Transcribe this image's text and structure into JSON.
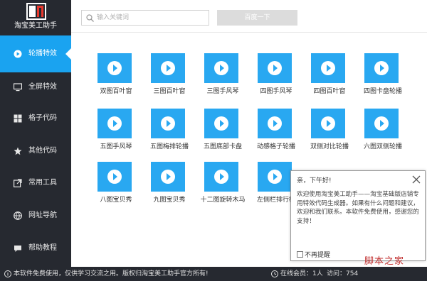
{
  "app": {
    "title": "淘宝美工助手"
  },
  "sidebar": {
    "items": [
      {
        "label": "轮播特效",
        "icon": "play-icon",
        "active": true
      },
      {
        "label": "全屏特效",
        "icon": "monitor-icon",
        "active": false
      },
      {
        "label": "格子代码",
        "icon": "grid-icon",
        "active": false
      },
      {
        "label": "其他代码",
        "icon": "star-icon",
        "active": false
      },
      {
        "label": "常用工具",
        "icon": "external-link-icon",
        "active": false
      },
      {
        "label": "网址导航",
        "icon": "globe-icon",
        "active": false
      },
      {
        "label": "帮助教程",
        "icon": "chat-icon",
        "active": false
      }
    ]
  },
  "search": {
    "placeholder": "输入关键词",
    "button_label": "百度一下"
  },
  "tiles": [
    "双图百叶窗",
    "三图百叶窗",
    "三图手风琴",
    "四图手风琴",
    "四图百叶窗",
    "四图卡盘轮播",
    "五图手风琴",
    "五图梅排轮播",
    "五图底部卡盘",
    "动感格子轮播",
    "双侧对比轮播",
    "六图双侧轮播",
    "八图宝贝秀",
    "九图宝贝秀",
    "十二图旋转木马",
    "左侧栏排行榜"
  ],
  "popup": {
    "title": "亲，下午好!",
    "body": "欢迎使用淘宝美工助手——淘宝基础版店铺专用特效代码生成器。如果有什么问题和建议，欢迎和我们联系。本软件免费使用，感谢您的支持！",
    "checkbox_label": "不再提醒"
  },
  "status": {
    "notice": "本软件免费使用，仅供学习交流之用。版权归淘宝美工助手官方所有!",
    "online": "在线会员：1人",
    "visits": "访问：754"
  },
  "watermark": "脚本之家",
  "colors": {
    "sidebar": "#262930",
    "accent": "#1aa3f0",
    "tile": "#29a8f1"
  }
}
